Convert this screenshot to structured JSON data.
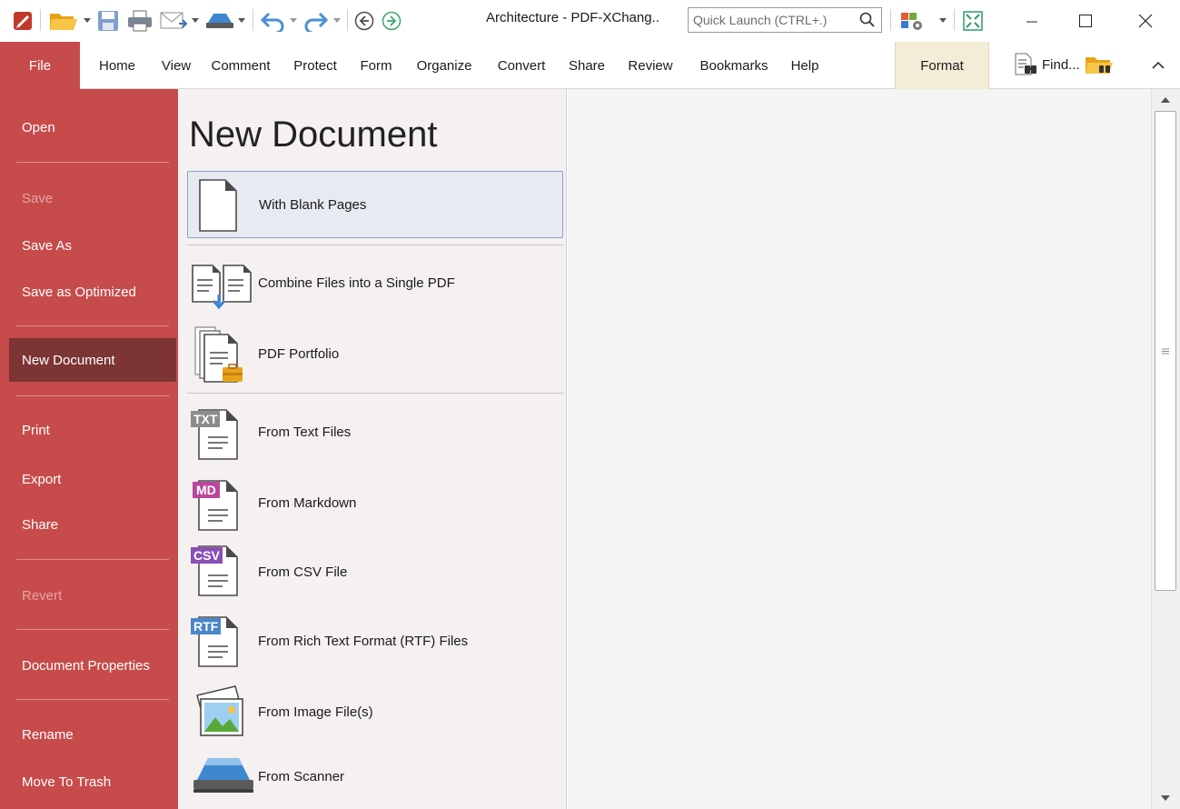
{
  "window": {
    "title": "Architecture - PDF-XChang..",
    "quick_launch_placeholder": "Quick Launch (CTRL+.)"
  },
  "ribbon": {
    "file": "File",
    "tabs": [
      "Home",
      "View",
      "Comment",
      "Protect",
      "Form",
      "Organize",
      "Convert",
      "Share",
      "Review",
      "Bookmarks",
      "Help"
    ],
    "format": "Format",
    "find": "Find..."
  },
  "nav": {
    "open": "Open",
    "save": "Save",
    "save_as": "Save As",
    "save_optimized": "Save as Optimized",
    "new_document": "New Document",
    "print": "Print",
    "export": "Export",
    "share": "Share",
    "revert": "Revert",
    "document_properties": "Document Properties",
    "rename": "Rename",
    "move_to_trash": "Move To Trash"
  },
  "panel": {
    "title": "New Document",
    "with_blank_pages": "With Blank Pages",
    "combine_files": "Combine Files into a Single PDF",
    "pdf_portfolio": "PDF Portfolio",
    "from_text_files": "From Text Files",
    "from_markdown": "From Markdown",
    "from_csv": "From CSV File",
    "from_rtf": "From Rich Text Format (RTF) Files",
    "from_image": "From Image File(s)",
    "from_scanner": "From Scanner"
  },
  "badges": {
    "txt": "TXT",
    "md": "MD",
    "csv": "CSV",
    "rtf": "RTF"
  },
  "colors": {
    "accent": "#c74b4b",
    "nav_active": "#7c3434",
    "format_tab": "#f3ecd7",
    "panel_bg": "#f4f1f0",
    "selection": "#e7eaf0",
    "badge_txt": "#8c8c8c",
    "badge_md": "#b9479b",
    "badge_csv": "#8a4fb5",
    "badge_rtf": "#4a86c7"
  },
  "icons": {
    "app": "pdf-xchange-logo-icon",
    "open": "open-folder-icon",
    "save": "save-icon",
    "print": "print-icon",
    "email": "email-icon",
    "scan": "scan-icon",
    "undo": "undo-icon",
    "redo": "redo-icon",
    "back": "back-icon",
    "forward": "forward-icon",
    "search": "search-icon",
    "customize": "customize-toolbar-icon",
    "fullscreen": "fullscreen-icon",
    "minimize": "minimize-icon",
    "maximize": "maximize-icon",
    "close": "close-icon"
  }
}
